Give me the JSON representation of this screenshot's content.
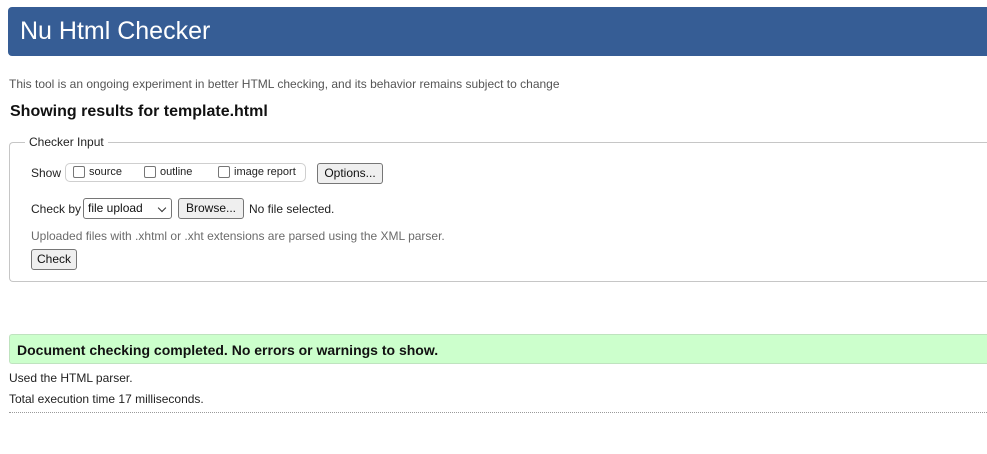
{
  "header": {
    "title": "Nu Html Checker"
  },
  "tagline": "This tool is an ongoing experiment in better HTML checking, and its behavior remains subject to change",
  "results_title": "Showing results for template.html",
  "checker_input": {
    "legend": "Checker Input",
    "show_label": "Show",
    "show_options": [
      {
        "label": "source",
        "checked": false
      },
      {
        "label": "outline",
        "checked": false
      },
      {
        "label": "image report",
        "checked": false
      }
    ],
    "options_button": "Options...",
    "check_by_label": "Check by",
    "check_by_selected": "file upload",
    "browse_button": "Browse...",
    "file_status": "No file selected.",
    "hint": "Uploaded files with .xhtml or .xht extensions are parsed using the XML parser.",
    "check_button": "Check"
  },
  "result": {
    "message": "Document checking completed. No errors or warnings to show.",
    "parser_info": "Used the HTML parser.",
    "execution_time": "Total execution time 17 milliseconds."
  },
  "colors": {
    "header_bg": "#365d95",
    "success_bg": "#ccffcc"
  }
}
